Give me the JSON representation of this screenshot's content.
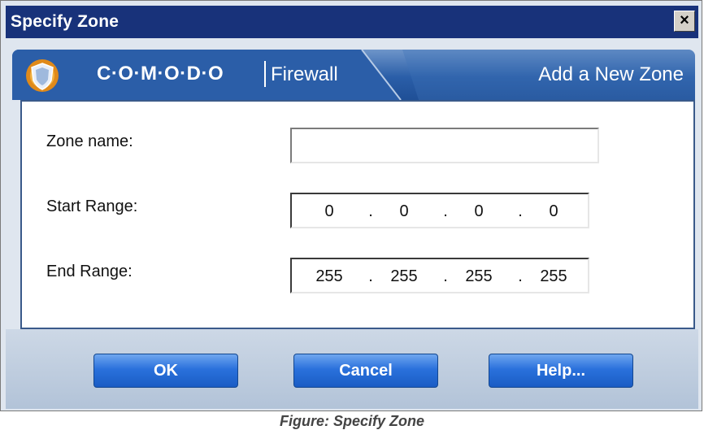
{
  "window": {
    "title": "Specify Zone",
    "close_label": "×"
  },
  "banner": {
    "brand": "C·O·M·O·D·O",
    "product": "Firewall",
    "heading": "Add a New Zone"
  },
  "form": {
    "zone_name_label": "Zone name:",
    "zone_name_value": "",
    "start_range_label": "Start Range:",
    "start_range": [
      "0",
      "0",
      "0",
      "0"
    ],
    "end_range_label": "End Range:",
    "end_range": [
      "255",
      "255",
      "255",
      "255"
    ]
  },
  "buttons": {
    "ok": "OK",
    "cancel": "Cancel",
    "help": "Help..."
  },
  "caption": "Figure: Specify Zone",
  "colors": {
    "title_bar": "#18327a",
    "banner": "#2a5ea8",
    "button": "#2a71dc",
    "dialog_bg": "#dfe6ef"
  },
  "icons": {
    "logo": "comodo-shield-icon",
    "close": "close-icon"
  }
}
